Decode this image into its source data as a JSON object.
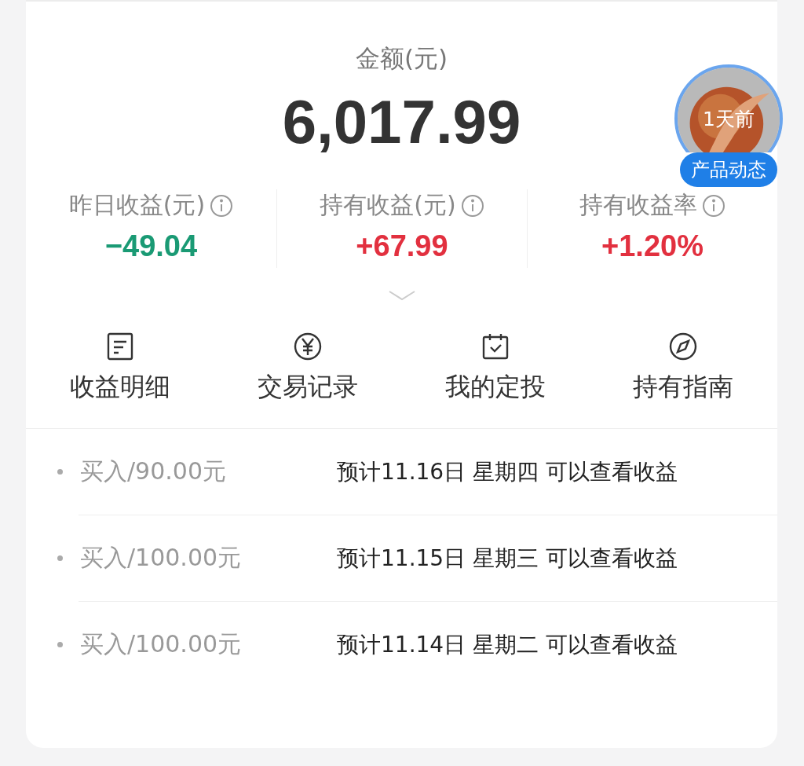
{
  "summary": {
    "label": "金额(元)",
    "amount": "6,017.99"
  },
  "badge": {
    "time": "1天前",
    "label": "产品动态"
  },
  "stats": [
    {
      "label": "昨日收益(元)",
      "value": "−49.04",
      "color": "#1a9a74"
    },
    {
      "label": "持有收益(元)",
      "value": "+67.99",
      "color": "#e2303f"
    },
    {
      "label": "持有收益率",
      "value": "+1.20%",
      "color": "#e2303f"
    }
  ],
  "actions": [
    {
      "label": "收益明细",
      "kind": "list"
    },
    {
      "label": "交易记录",
      "kind": "yen"
    },
    {
      "label": "我的定投",
      "kind": "calendar"
    },
    {
      "label": "持有指南",
      "kind": "compass"
    }
  ],
  "records": [
    {
      "title": "买入/90.00元",
      "note": "预计11.16日 星期四 可以查看收益"
    },
    {
      "title": "买入/100.00元",
      "note": "预计11.15日 星期三 可以查看收益"
    },
    {
      "title": "买入/100.00元",
      "note": "预计11.14日 星期二 可以查看收益"
    }
  ]
}
